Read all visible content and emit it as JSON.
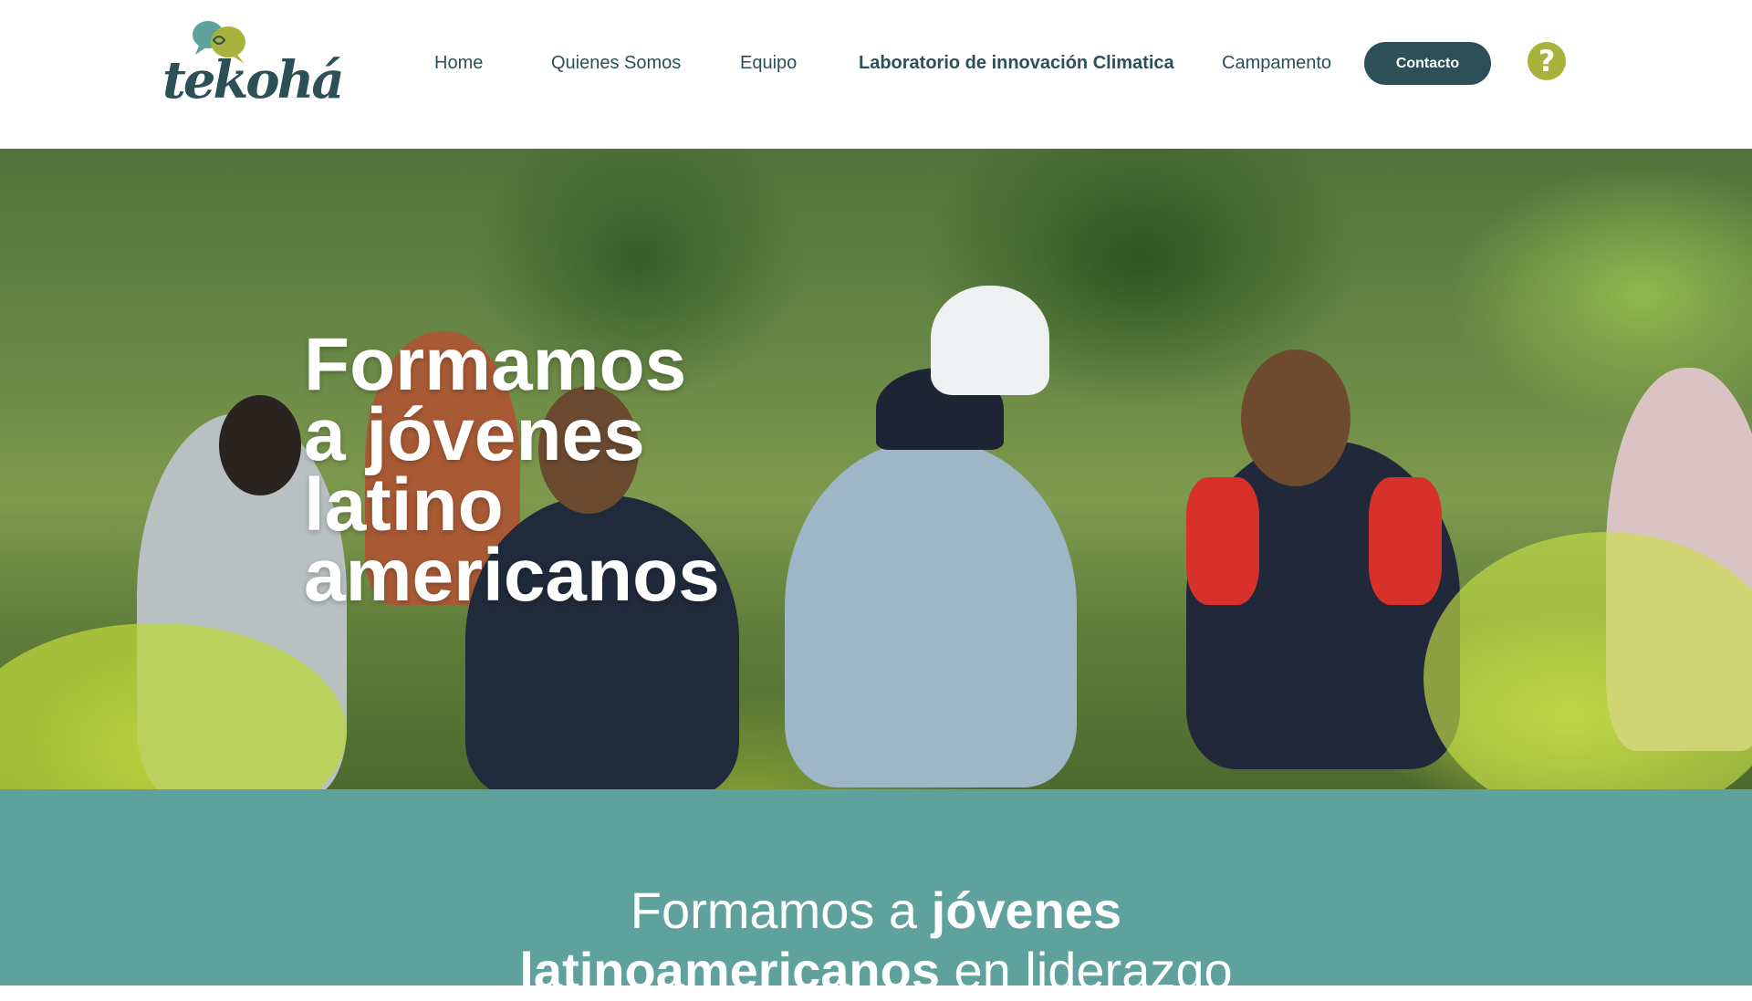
{
  "brand": {
    "logo_text": "tekohá",
    "colors": {
      "dark_teal": "#2c4f58",
      "teal": "#5fa19c",
      "olive": "#a8b33c"
    }
  },
  "nav": {
    "items": [
      {
        "label": "Home"
      },
      {
        "label": "Quienes Somos"
      },
      {
        "label": "Equipo"
      },
      {
        "label": "Laboratorio de innovación Climatica"
      },
      {
        "label": "Campamento"
      }
    ],
    "contact_label": "Contacto",
    "help_icon": "question-mark-icon",
    "help_glyph": "?"
  },
  "hero": {
    "title_lines": [
      "Formamos",
      "a jóvenes",
      "latino",
      "americanos"
    ]
  },
  "intro": {
    "line1_regular": "Formamos a ",
    "line1_bold": "jóvenes",
    "line2_bold": "latinoamericanos",
    "line2_regular": " en liderazgo"
  }
}
